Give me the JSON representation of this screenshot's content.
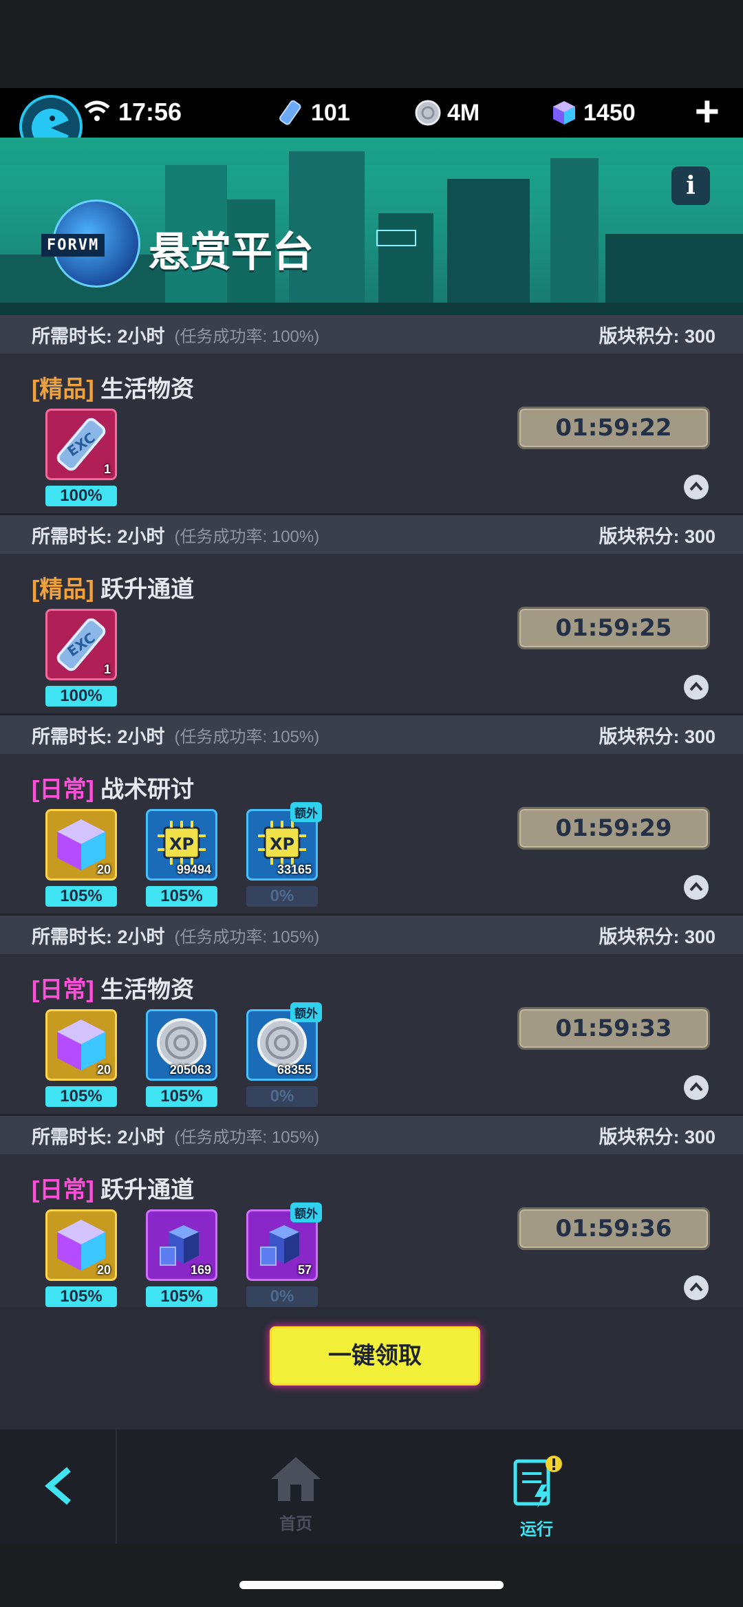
{
  "status": {
    "time": "17:56",
    "resources": [
      {
        "icon": "ticket-icon",
        "value": "101"
      },
      {
        "icon": "coin-icon",
        "value": "4M"
      },
      {
        "icon": "cube-icon",
        "value": "1450"
      }
    ],
    "plus_label": "+"
  },
  "banner": {
    "badge": "FORVM",
    "title": "悬赏平台",
    "info_label": "i"
  },
  "tasks": [
    {
      "duration": "所需时长: 2小时",
      "rate": "(任务成功率: 100%)",
      "score": "版块积分: 300",
      "tag": "[精品]",
      "name": "生活物资",
      "timer": "01:59:22",
      "rewards": [
        {
          "icon": "ticket-icon",
          "qty": "1",
          "pct": "100%"
        }
      ]
    },
    {
      "duration": "所需时长: 2小时",
      "rate": "(任务成功率: 100%)",
      "score": "版块积分: 300",
      "tag": "[精品]",
      "name": "跃升通道",
      "timer": "01:59:25",
      "rewards": [
        {
          "icon": "ticket-icon",
          "qty": "1",
          "pct": "100%"
        }
      ]
    },
    {
      "duration": "所需时长: 2小时",
      "rate": "(任务成功率: 105%)",
      "score": "版块积分: 300",
      "tag": "[日常]",
      "name": "战术研讨",
      "timer": "01:59:29",
      "rewards": [
        {
          "icon": "cube-icon",
          "qty": "20",
          "pct": "105%"
        },
        {
          "icon": "xp-chip-icon",
          "qty": "99494",
          "pct": "105%"
        },
        {
          "icon": "xp-chip-icon",
          "qty": "33165",
          "pct": "0%",
          "extra": "额外"
        }
      ]
    },
    {
      "duration": "所需时长: 2小时",
      "rate": "(任务成功率: 105%)",
      "score": "版块积分: 300",
      "tag": "[日常]",
      "name": "生活物资",
      "timer": "01:59:33",
      "rewards": [
        {
          "icon": "cube-icon",
          "qty": "20",
          "pct": "105%"
        },
        {
          "icon": "coin-icon",
          "qty": "205063",
          "pct": "105%"
        },
        {
          "icon": "coin-icon",
          "qty": "68355",
          "pct": "0%",
          "extra": "额外"
        }
      ]
    },
    {
      "duration": "所需时长: 2小时",
      "rate": "(任务成功率: 105%)",
      "score": "版块积分: 300",
      "tag": "[日常]",
      "name": "跃升通道",
      "timer": "01:59:36",
      "rewards": [
        {
          "icon": "cube-icon",
          "qty": "20",
          "pct": "105%"
        },
        {
          "icon": "block-icon",
          "qty": "169",
          "pct": "105%"
        },
        {
          "icon": "block-icon",
          "qty": "57",
          "pct": "0%",
          "extra": "额外"
        }
      ]
    }
  ],
  "claim_label": "一键领取",
  "nav": {
    "home_label": "首页",
    "run_label": "运行"
  }
}
